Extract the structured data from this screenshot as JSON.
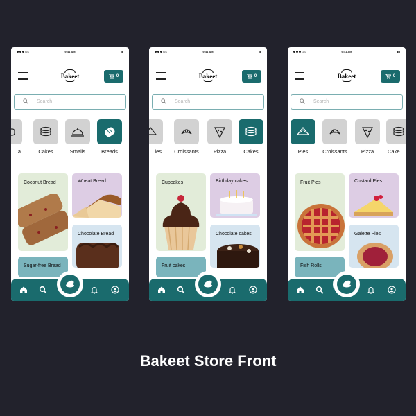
{
  "caption": "Bakeet Store Front",
  "status": {
    "carrier": "GS",
    "time": "9:41 AM"
  },
  "app": {
    "logo": "Bakeet",
    "cart_count": "0",
    "search_placeholder": "Search"
  },
  "screens": [
    {
      "categories": [
        {
          "label": "a",
          "icon": "bread-icon",
          "active": false
        },
        {
          "label": "Cakes",
          "icon": "pancake-stack-icon",
          "active": false
        },
        {
          "label": "Smalls",
          "icon": "cloche-icon",
          "active": false
        },
        {
          "label": "Breads",
          "icon": "bread-loaf-icon",
          "active": true
        }
      ],
      "cards": [
        {
          "title": "Coconut Bread"
        },
        {
          "title": "Wheat Bread"
        },
        {
          "title": "Chocolate Bread"
        },
        {
          "title": "Sugar-free Bread"
        }
      ]
    },
    {
      "categories": [
        {
          "label": "ies",
          "icon": "pie-icon",
          "active": false
        },
        {
          "label": "Croissants",
          "icon": "croissant-icon",
          "active": false
        },
        {
          "label": "Pizza",
          "icon": "pizza-slice-icon",
          "active": false
        },
        {
          "label": "Cakes",
          "icon": "pancake-stack-icon",
          "active": true
        }
      ],
      "cards": [
        {
          "title": "Cupcakes"
        },
        {
          "title": "Birthday cakes"
        },
        {
          "title": "Chocolate cakes"
        },
        {
          "title": "Fruit cakes"
        }
      ]
    },
    {
      "categories": [
        {
          "label": "Pies",
          "icon": "pie-icon",
          "active": true
        },
        {
          "label": "Croissants",
          "icon": "croissant-icon",
          "active": false
        },
        {
          "label": "Pizza",
          "icon": "pizza-slice-icon",
          "active": false
        },
        {
          "label": "Cake",
          "icon": "pancake-stack-icon",
          "active": false
        }
      ],
      "cards": [
        {
          "title": "Fruit Pies"
        },
        {
          "title": "Custard Pies"
        },
        {
          "title": "Galette Pies"
        },
        {
          "title": "Fish Rolls"
        }
      ]
    }
  ],
  "colors": {
    "primary": "#1a6b6d",
    "background": "#22222c",
    "chip_inactive": "#d2d2d2"
  }
}
